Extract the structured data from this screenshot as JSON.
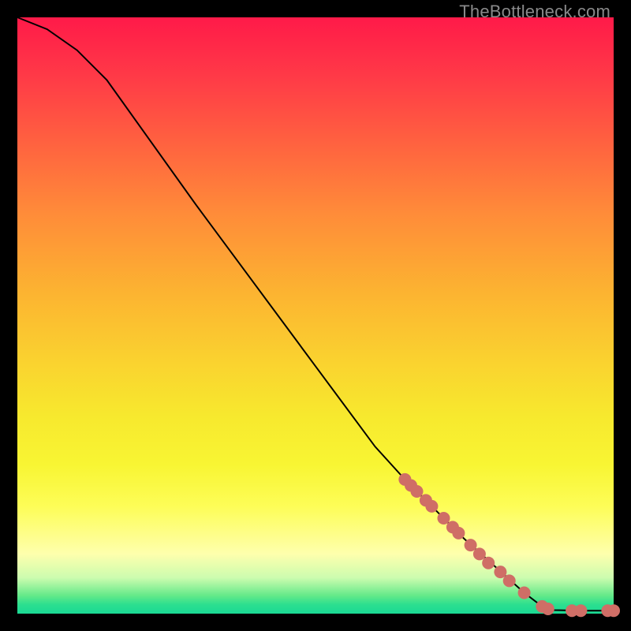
{
  "watermark": "TheBottleneck.com",
  "colors": {
    "dot": "#cf6e66",
    "line": "#000000"
  },
  "chart_data": {
    "type": "line",
    "title": "",
    "xlabel": "",
    "ylabel": "",
    "xlim": [
      0,
      100
    ],
    "ylim": [
      0,
      100
    ],
    "grid": false,
    "legend": false,
    "note": "Axes are unlabeled; values below are estimated from pixel position relative to plot extents (0–100 each axis, y increases upward).",
    "curve": [
      {
        "x": 0.0,
        "y": 100.0
      },
      {
        "x": 5.0,
        "y": 98.0
      },
      {
        "x": 10.0,
        "y": 94.5
      },
      {
        "x": 15.0,
        "y": 89.5
      },
      {
        "x": 20.0,
        "y": 82.5
      },
      {
        "x": 30.0,
        "y": 68.5
      },
      {
        "x": 40.0,
        "y": 55.0
      },
      {
        "x": 50.0,
        "y": 41.5
      },
      {
        "x": 60.0,
        "y": 28.0
      },
      {
        "x": 65.0,
        "y": 22.5
      },
      {
        "x": 70.0,
        "y": 17.5
      },
      {
        "x": 75.0,
        "y": 12.5
      },
      {
        "x": 80.0,
        "y": 8.0
      },
      {
        "x": 85.0,
        "y": 3.5
      },
      {
        "x": 88.0,
        "y": 1.2
      },
      {
        "x": 90.0,
        "y": 0.6
      },
      {
        "x": 95.0,
        "y": 0.5
      },
      {
        "x": 100.0,
        "y": 0.5
      }
    ],
    "points": [
      {
        "x": 65.0,
        "y": 22.5
      },
      {
        "x": 66.0,
        "y": 21.5
      },
      {
        "x": 67.0,
        "y": 20.5
      },
      {
        "x": 68.5,
        "y": 19.0
      },
      {
        "x": 69.5,
        "y": 18.0
      },
      {
        "x": 71.5,
        "y": 16.0
      },
      {
        "x": 73.0,
        "y": 14.5
      },
      {
        "x": 74.0,
        "y": 13.5
      },
      {
        "x": 76.0,
        "y": 11.5
      },
      {
        "x": 77.5,
        "y": 10.0
      },
      {
        "x": 79.0,
        "y": 8.5
      },
      {
        "x": 81.0,
        "y": 7.0
      },
      {
        "x": 82.5,
        "y": 5.5
      },
      {
        "x": 85.0,
        "y": 3.5
      },
      {
        "x": 88.0,
        "y": 1.2
      },
      {
        "x": 89.0,
        "y": 0.8
      },
      {
        "x": 93.0,
        "y": 0.5
      },
      {
        "x": 94.5,
        "y": 0.5
      },
      {
        "x": 99.0,
        "y": 0.5
      },
      {
        "x": 100.0,
        "y": 0.5
      }
    ]
  }
}
